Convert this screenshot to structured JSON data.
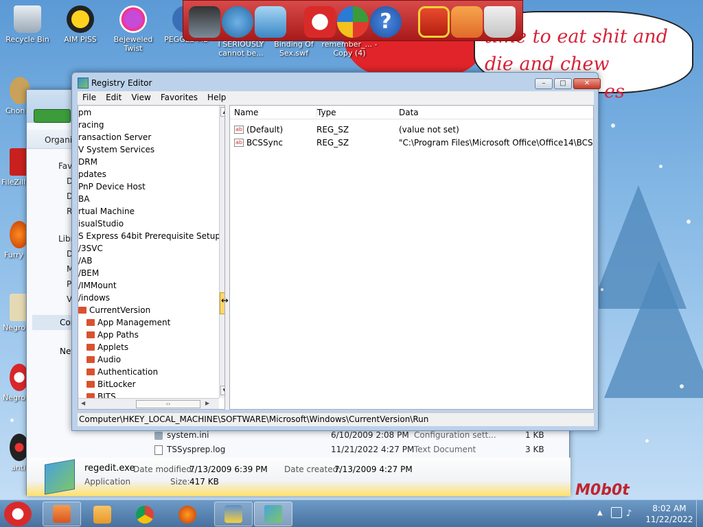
{
  "desktop": {
    "icons": [
      {
        "label": "Recycle Bin"
      },
      {
        "label": "AIM PISS"
      },
      {
        "label": "Bejeweled Twist"
      },
      {
        "label": "PEGGLE ME"
      },
      {
        "label": "I SERIOUSLY cannot be..."
      },
      {
        "label": "Binding Of Sex.swf"
      },
      {
        "label": "remember_... - Copy (4)"
      }
    ],
    "left_icons": [
      {
        "label": "Chon"
      },
      {
        "label": "FileZill"
      },
      {
        "label": "Furry"
      },
      {
        "label": "Negro"
      },
      {
        "label": "Negro"
      },
      {
        "label": "anti"
      }
    ],
    "bubble_text": "time to eat shit and die and chew",
    "bubble_tail": "es",
    "wallpaper_tag": "M0b0t"
  },
  "explorer": {
    "organize": "Organi",
    "nav_items": [
      "Fav",
      "D",
      "D",
      "R",
      "Libr",
      "D",
      "M",
      "P",
      "V",
      "Cor",
      "Net"
    ],
    "files": [
      {
        "name": "system.ini",
        "date": "6/10/2009 2:08 PM",
        "type": "Configuration sett...",
        "size": "1 KB"
      },
      {
        "name": "TSSysprep.log",
        "date": "11/21/2022 4:27 PM",
        "type": "Text Document",
        "size": "3 KB"
      }
    ],
    "details": {
      "name": "regedit.exe",
      "modified_label": "Date modified:",
      "modified": "7/13/2009 6:39 PM",
      "created_label": "Date created:",
      "created": "7/13/2009 4:27 PM",
      "kind": "Application",
      "size_label": "Size:",
      "size": "417 KB"
    }
  },
  "regedit": {
    "title": "Registry Editor",
    "menu": [
      "File",
      "Edit",
      "View",
      "Favorites",
      "Help"
    ],
    "tree": [
      {
        "label": "pm",
        "indent": 0,
        "folder": false
      },
      {
        "label": "racing",
        "indent": 0,
        "folder": false
      },
      {
        "label": "ransaction Server",
        "indent": 0,
        "folder": false
      },
      {
        "label": "V System Services",
        "indent": 0,
        "folder": false
      },
      {
        "label": "DRM",
        "indent": 0,
        "folder": false
      },
      {
        "label": "pdates",
        "indent": 0,
        "folder": false
      },
      {
        "label": "PnP Device Host",
        "indent": 0,
        "folder": false
      },
      {
        "label": "BA",
        "indent": 0,
        "folder": false
      },
      {
        "label": "rtual Machine",
        "indent": 0,
        "folder": false
      },
      {
        "label": "isualStudio",
        "indent": 0,
        "folder": false
      },
      {
        "label": "S Express 64bit Prerequisite Setup",
        "indent": 0,
        "folder": false
      },
      {
        "label": "/3SVC",
        "indent": 0,
        "folder": false
      },
      {
        "label": "/AB",
        "indent": 0,
        "folder": false
      },
      {
        "label": "/BEM",
        "indent": 0,
        "folder": false
      },
      {
        "label": "/IMMount",
        "indent": 0,
        "folder": false
      },
      {
        "label": "/indows",
        "indent": 0,
        "folder": false
      },
      {
        "label": "CurrentVersion",
        "indent": 1,
        "folder": true
      },
      {
        "label": "App Management",
        "indent": 2,
        "folder": true
      },
      {
        "label": "App Paths",
        "indent": 2,
        "folder": true
      },
      {
        "label": "Applets",
        "indent": 2,
        "folder": true
      },
      {
        "label": "Audio",
        "indent": 2,
        "folder": true
      },
      {
        "label": "Authentication",
        "indent": 2,
        "folder": true
      },
      {
        "label": "BitLocker",
        "indent": 2,
        "folder": true
      },
      {
        "label": "BITS",
        "indent": 2,
        "folder": true
      }
    ],
    "columns": {
      "name": "Name",
      "type": "Type",
      "data": "Data"
    },
    "values": [
      {
        "name": "(Default)",
        "type": "REG_SZ",
        "data": "(value not set)"
      },
      {
        "name": "BCSSync",
        "type": "REG_SZ",
        "data": "\"C:\\Program Files\\Microsoft Office\\Office14\\BCSS..."
      }
    ],
    "status_path": "Computer\\HKEY_LOCAL_MACHINE\\SOFTWARE\\Microsoft\\Windows\\CurrentVersion\\Run"
  },
  "taskbar": {
    "time": "8:02 AM",
    "date": "11/22/2022"
  }
}
